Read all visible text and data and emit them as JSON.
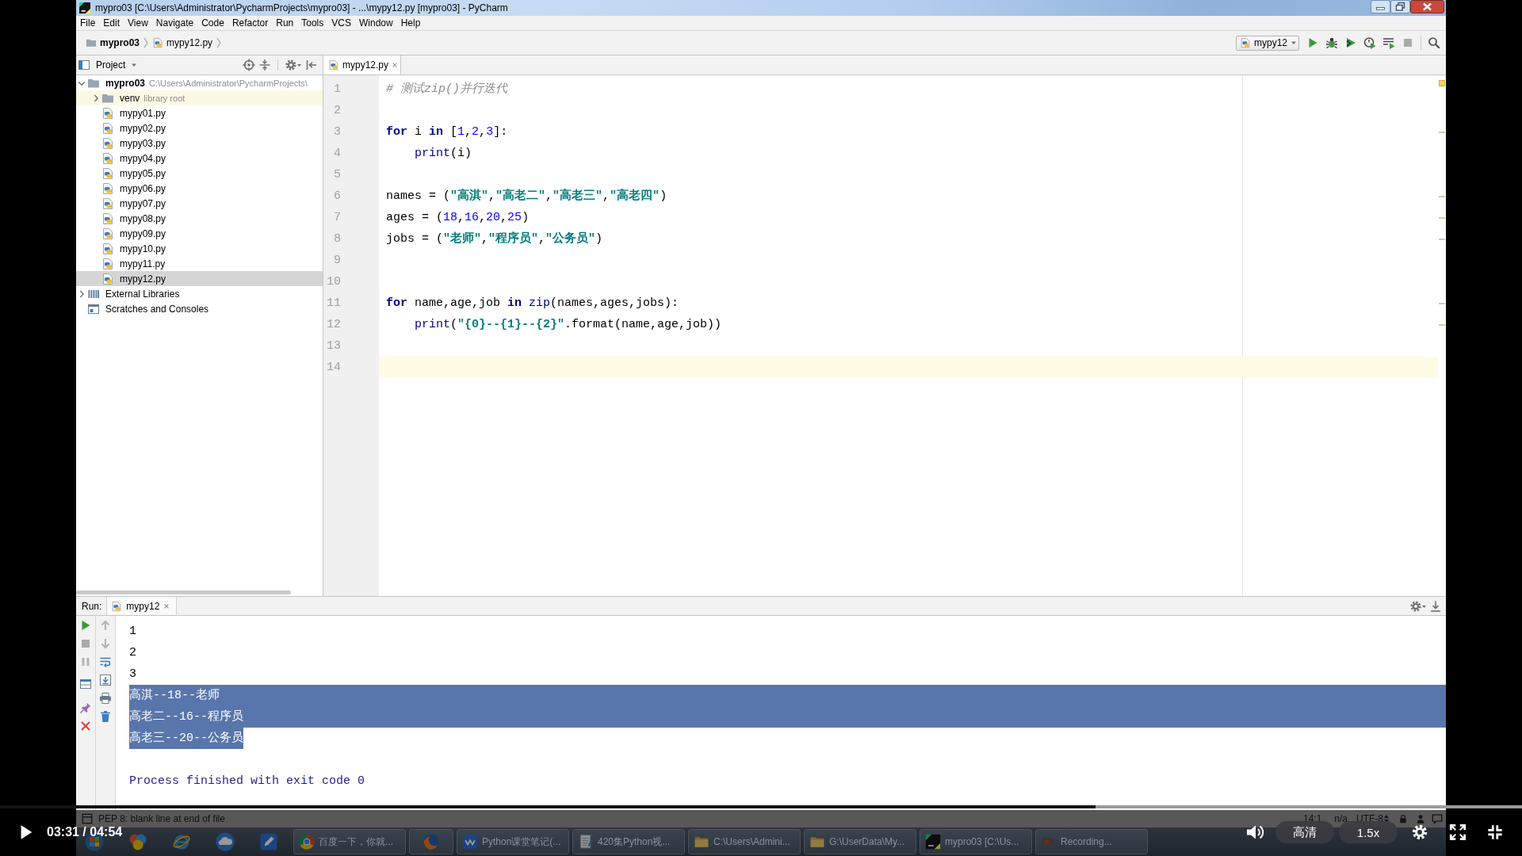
{
  "window": {
    "title": "mypro03 [C:\\Users\\Administrator\\PycharmProjects\\mypro03] - ...\\mypy12.py [mypro03] - PyCharm"
  },
  "menu": [
    "File",
    "Edit",
    "View",
    "Navigate",
    "Code",
    "Refactor",
    "Run",
    "Tools",
    "VCS",
    "Window",
    "Help"
  ],
  "navigation": {
    "breadcrumbs": [
      {
        "label": "mypro03",
        "kind": "folder"
      },
      {
        "label": "mypy12.py",
        "kind": "file"
      }
    ],
    "run_configuration": "mypy12",
    "actions": [
      {
        "kind": "run",
        "disabled": false
      },
      {
        "kind": "debug",
        "disabled": false
      },
      {
        "kind": "coverage",
        "disabled": false
      },
      {
        "kind": "profile",
        "disabled": false
      },
      {
        "kind": "concurrency",
        "disabled": false
      },
      {
        "kind": "stop",
        "disabled": true
      },
      {
        "kind": "search",
        "disabled": false
      }
    ]
  },
  "project_panel": {
    "title": "Project",
    "tree": [
      {
        "label": "mypro03",
        "hint": "C:\\Users\\Administrator\\PycharmProjects\\",
        "kind": "project",
        "expanded": true,
        "selected": false,
        "children": [
          {
            "label": "venv",
            "hint": "library root",
            "kind": "library_root",
            "expanded": false,
            "selected": false
          },
          {
            "label": "mypy01.py",
            "kind": "file",
            "selected": false
          },
          {
            "label": "mypy02.py",
            "kind": "file",
            "selected": false
          },
          {
            "label": "mypy03.py",
            "kind": "file",
            "selected": false
          },
          {
            "label": "mypy04.py",
            "kind": "file",
            "selected": false
          },
          {
            "label": "mypy05.py",
            "kind": "file",
            "selected": false
          },
          {
            "label": "mypy06.py",
            "kind": "file",
            "selected": false
          },
          {
            "label": "mypy07.py",
            "kind": "file",
            "selected": false
          },
          {
            "label": "mypy08.py",
            "kind": "file",
            "selected": false
          },
          {
            "label": "mypy09.py",
            "kind": "file",
            "selected": false
          },
          {
            "label": "mypy10.py",
            "kind": "file",
            "selected": false
          },
          {
            "label": "mypy11.py",
            "kind": "file",
            "selected": false
          },
          {
            "label": "mypy12.py",
            "kind": "file",
            "selected": true
          }
        ]
      },
      {
        "label": "External Libraries",
        "kind": "libraries",
        "expanded": false,
        "selected": false
      },
      {
        "label": "Scratches and Consoles",
        "kind": "scratches",
        "selected": false
      }
    ]
  },
  "editor": {
    "tabs": [
      {
        "label": "mypy12.py",
        "selected": true
      }
    ],
    "lines": [
      {
        "number": "1",
        "current": false,
        "warning": false,
        "tokens": [
          {
            "kind": "comment",
            "text": "# 测试zip()并行迭代"
          }
        ]
      },
      {
        "number": "2",
        "current": false,
        "warning": false
      },
      {
        "number": "3",
        "current": false,
        "warning": true,
        "tokens": [
          {
            "kind": "keyword",
            "text": "for"
          },
          {
            "kind": "plain",
            "text": " i "
          },
          {
            "kind": "keyword",
            "text": "in"
          },
          {
            "kind": "plain",
            "text": " ["
          },
          {
            "kind": "number",
            "text": "1"
          },
          {
            "kind": "plain",
            "text": ","
          },
          {
            "kind": "number",
            "text": "2"
          },
          {
            "kind": "plain",
            "text": ","
          },
          {
            "kind": "number",
            "text": "3"
          },
          {
            "kind": "plain",
            "text": "]:"
          }
        ]
      },
      {
        "number": "4",
        "current": false,
        "warning": false,
        "tokens": [
          {
            "kind": "builtin",
            "text": "    print"
          },
          {
            "kind": "plain",
            "text": "(i)"
          }
        ]
      },
      {
        "number": "5",
        "current": false,
        "warning": false
      },
      {
        "number": "6",
        "current": false,
        "warning": true,
        "tokens": [
          {
            "kind": "plain",
            "text": "names = ("
          },
          {
            "kind": "string",
            "text": "\"高淇\""
          },
          {
            "kind": "plain",
            "text": ","
          },
          {
            "kind": "string",
            "text": "\"高老二\""
          },
          {
            "kind": "plain",
            "text": ","
          },
          {
            "kind": "string",
            "text": "\"高老三\""
          },
          {
            "kind": "plain",
            "text": ","
          },
          {
            "kind": "string",
            "text": "\"高老四\""
          },
          {
            "kind": "plain",
            "text": ")"
          }
        ]
      },
      {
        "number": "7",
        "current": false,
        "warning": true,
        "tokens": [
          {
            "kind": "plain",
            "text": "ages = ("
          },
          {
            "kind": "number",
            "text": "18"
          },
          {
            "kind": "plain",
            "text": ","
          },
          {
            "kind": "number",
            "text": "16"
          },
          {
            "kind": "plain",
            "text": ","
          },
          {
            "kind": "number",
            "text": "20"
          },
          {
            "kind": "plain",
            "text": ","
          },
          {
            "kind": "number",
            "text": "25"
          },
          {
            "kind": "plain",
            "text": ")"
          }
        ]
      },
      {
        "number": "8",
        "current": false,
        "warning": true,
        "tokens": [
          {
            "kind": "plain",
            "text": "jobs = ("
          },
          {
            "kind": "string",
            "text": "\"老师\""
          },
          {
            "kind": "plain",
            "text": ","
          },
          {
            "kind": "string",
            "text": "\"程序员\""
          },
          {
            "kind": "plain",
            "text": ","
          },
          {
            "kind": "string",
            "text": "\"公务员\""
          },
          {
            "kind": "plain",
            "text": ")"
          }
        ]
      },
      {
        "number": "9",
        "current": false,
        "warning": false
      },
      {
        "number": "10",
        "current": false,
        "warning": false
      },
      {
        "number": "11",
        "current": false,
        "warning": true,
        "tokens": [
          {
            "kind": "keyword",
            "text": "for"
          },
          {
            "kind": "plain",
            "text": " name,age,job "
          },
          {
            "kind": "keyword",
            "text": "in"
          },
          {
            "kind": "builtin",
            "text": " zip"
          },
          {
            "kind": "plain",
            "text": "(names,ages,jobs):"
          }
        ]
      },
      {
        "number": "12",
        "current": false,
        "warning": true,
        "tokens": [
          {
            "kind": "builtin",
            "text": "    print"
          },
          {
            "kind": "plain",
            "text": "("
          },
          {
            "kind": "string",
            "text": "\"{0}--{1}--{2}\""
          },
          {
            "kind": "plain",
            "text": ".format(name,age,job))"
          }
        ]
      },
      {
        "number": "13",
        "current": false,
        "warning": false
      },
      {
        "number": "14",
        "current": true,
        "warning": false
      }
    ]
  },
  "run_panel": {
    "label": "Run:",
    "tabs": [
      {
        "label": "mypy12",
        "selected": true
      }
    ],
    "toolbar": [
      [
        {
          "kind": "rerun",
          "disabled": false
        },
        {
          "kind": "stop",
          "disabled": true
        },
        {
          "kind": "pause",
          "disabled": true
        },
        {
          "kind": "layout",
          "disabled": false
        },
        {
          "kind": "pin",
          "disabled": false
        },
        {
          "kind": "close",
          "disabled": false
        }
      ],
      [
        {
          "kind": "previous",
          "disabled": true
        },
        {
          "kind": "next",
          "disabled": true
        },
        {
          "kind": "wrap",
          "disabled": false
        },
        {
          "kind": "scroll_end",
          "disabled": false
        },
        {
          "kind": "print",
          "disabled": false
        },
        {
          "kind": "clear",
          "disabled": false
        }
      ]
    ],
    "output": [
      {
        "kind": "stdout",
        "text": "1",
        "selected": false
      },
      {
        "kind": "stdout",
        "text": "2",
        "selected": false
      },
      {
        "kind": "stdout",
        "text": "3",
        "selected": false
      },
      {
        "kind": "stdout",
        "text": "高淇--18--老师",
        "selected": true
      },
      {
        "kind": "stdout",
        "text": "高老二--16--程序员",
        "selected": true
      },
      {
        "kind": "stdout",
        "text": "高老三--20--公务员",
        "selected": true
      },
      {
        "kind": "system",
        "text": "Process finished with exit code 0",
        "selected": false
      }
    ]
  },
  "status_bar": {
    "message": "PEP 8: blank line at end of file",
    "caret_position": "14:1",
    "vcs": "n/a",
    "encoding": "UTF-8"
  },
  "taskbar": {
    "pinned": [
      {
        "kind": "start"
      },
      {
        "kind": "media"
      },
      {
        "kind": "browser"
      },
      {
        "kind": "cloud"
      },
      {
        "kind": "pen"
      }
    ],
    "windows": [
      {
        "label": "百度一下，你就...",
        "kind": "ring"
      },
      {
        "kind": "globe"
      },
      {
        "label": "Python课堂笔记(...",
        "kind": "tile"
      },
      {
        "label": "420集Python视...",
        "kind": "notepad"
      },
      {
        "label": "C:\\Users\\Admini...",
        "kind": "folder"
      },
      {
        "label": "G:\\UserData\\My...",
        "kind": "folder"
      },
      {
        "label": "mypro03 [C:\\Us...",
        "kind": "app"
      },
      {
        "label": "Recording...",
        "kind": "camcorder"
      }
    ]
  },
  "player": {
    "playing": false,
    "time": "03:31 / 04:54",
    "level": 0.72,
    "quality": "高清",
    "speed": "1.5x"
  }
}
